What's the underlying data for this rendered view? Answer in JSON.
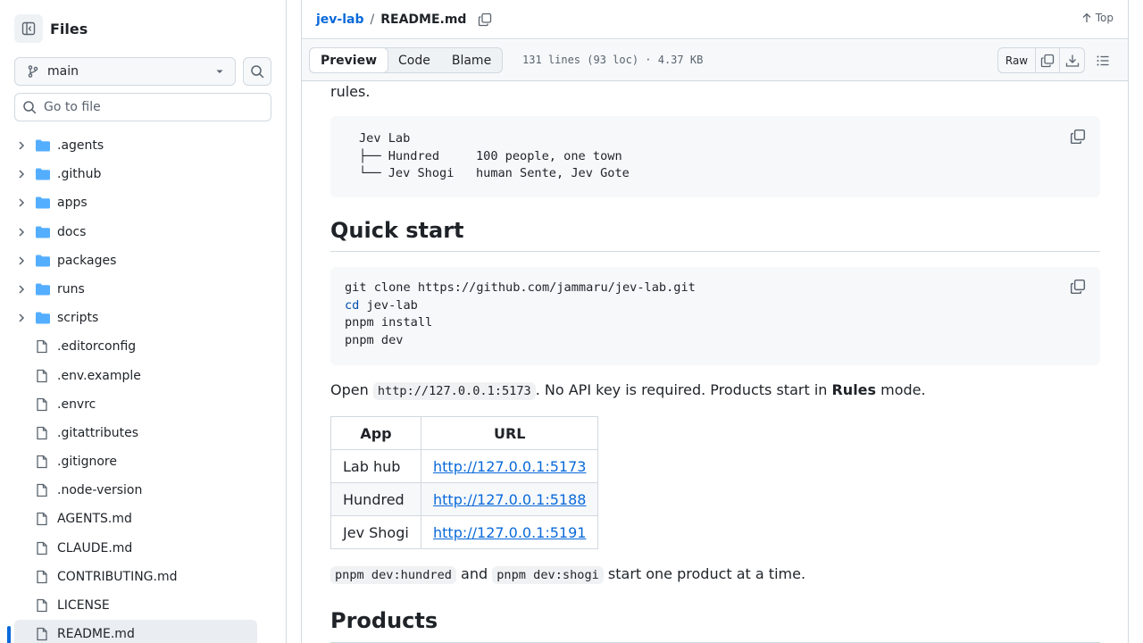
{
  "sidebar": {
    "title": "Files",
    "branch": "main",
    "goto_placeholder": "Go to file",
    "items": [
      {
        "type": "folder",
        "name": ".agents"
      },
      {
        "type": "folder",
        "name": ".github"
      },
      {
        "type": "folder",
        "name": "apps"
      },
      {
        "type": "folder",
        "name": "docs"
      },
      {
        "type": "folder",
        "name": "packages"
      },
      {
        "type": "folder",
        "name": "runs"
      },
      {
        "type": "folder",
        "name": "scripts"
      },
      {
        "type": "file",
        "name": ".editorconfig"
      },
      {
        "type": "file",
        "name": ".env.example"
      },
      {
        "type": "file",
        "name": ".envrc"
      },
      {
        "type": "file",
        "name": ".gitattributes"
      },
      {
        "type": "file",
        "name": ".gitignore"
      },
      {
        "type": "file",
        "name": ".node-version"
      },
      {
        "type": "file",
        "name": "AGENTS.md"
      },
      {
        "type": "file",
        "name": "CLAUDE.md"
      },
      {
        "type": "file",
        "name": "CONTRIBUTING.md"
      },
      {
        "type": "file",
        "name": "LICENSE"
      },
      {
        "type": "file",
        "name": "README.md",
        "active": true
      }
    ]
  },
  "header": {
    "repo": "jev-lab",
    "separator": "/",
    "file": "README.md",
    "top_label": "Top"
  },
  "toolbar": {
    "tabs": [
      "Preview",
      "Code",
      "Blame"
    ],
    "active_tab": "Preview",
    "file_meta": "131 lines (93 loc) · 4.37 KB",
    "raw_label": "Raw"
  },
  "readme": {
    "intro_tail": "rules.",
    "tree_code": "Jev Lab\n├── Hundred     100 people, one town\n└── Jev Shogi   human Sente, Jev Gote",
    "quick_start_heading": "Quick start",
    "clone_line": "git clone https://github.com/jammaru/jev-lab.git",
    "cd_kw": "cd",
    "cd_arg": " jev-lab",
    "install_line": "pnpm install",
    "dev_line": "pnpm dev",
    "open_prefix": "Open ",
    "open_url": "http://127.0.0.1:5173",
    "open_mid": ". No API key is required. Products start in ",
    "open_bold": "Rules",
    "open_suffix": " mode.",
    "table_headers": [
      "App",
      "URL"
    ],
    "table_rows": [
      {
        "app": "Lab hub",
        "url": "http://127.0.0.1:5173"
      },
      {
        "app": "Hundred",
        "url": "http://127.0.0.1:5188"
      },
      {
        "app": "Jev Shogi",
        "url": "http://127.0.0.1:5191"
      }
    ],
    "cmd1": "pnpm dev:hundred",
    "and_text": " and ",
    "cmd2": "pnpm dev:shogi",
    "start_text": " start one product at a time.",
    "products_heading": "Products"
  }
}
